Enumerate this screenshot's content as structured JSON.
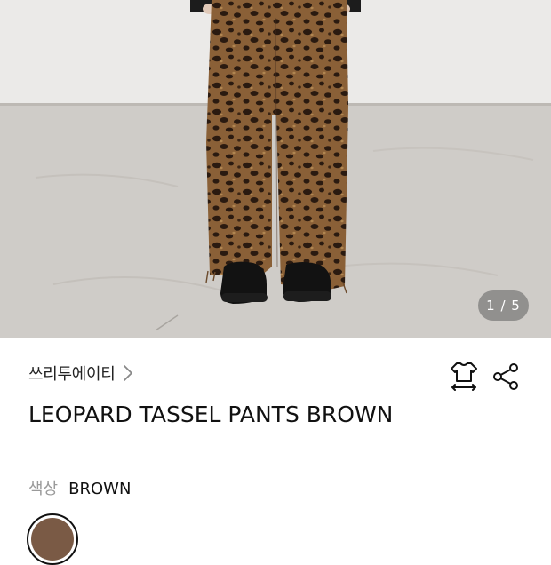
{
  "gallery": {
    "counter": "1 / 5",
    "image_alt": "Leopard print wide pants worn with black chunky shoes"
  },
  "product": {
    "brand": "쓰리투에이티",
    "title": "LEOPARD TASSEL PANTS BROWN",
    "color_label": "색상",
    "color_value": "BROWN",
    "swatch_color": "#7a5a45"
  },
  "icons": {
    "brand_link": "chevron-right-icon",
    "fit": "size-fit-icon",
    "share": "share-icon"
  }
}
